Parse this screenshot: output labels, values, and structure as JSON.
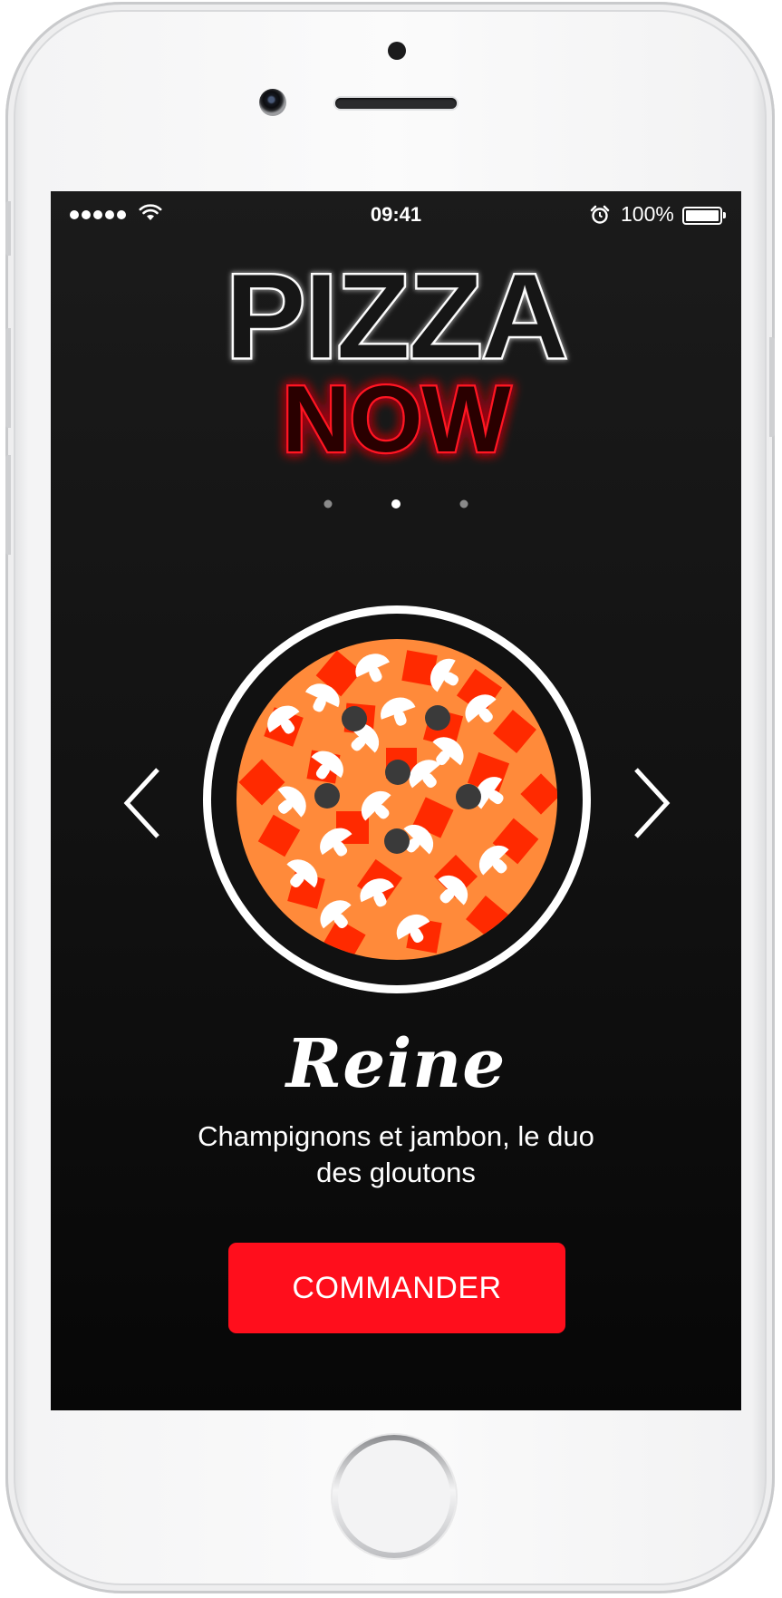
{
  "status_bar": {
    "time": "09:41",
    "battery_percent": "100%",
    "signal_bars": 5,
    "battery_level": 1.0
  },
  "logo": {
    "line1": "PIZZA",
    "line2": "NOW"
  },
  "carousel": {
    "page_count": 3,
    "active_index": 1,
    "prev_icon": "chevron-left-icon",
    "next_icon": "chevron-right-icon"
  },
  "pizza": {
    "name": "Reine",
    "description": "Champignons et jambon, le duo des gloutons"
  },
  "actions": {
    "order_label": "COMMANDER"
  },
  "colors": {
    "accent_red": "#ff0e1c",
    "neon_red": "#ff1220",
    "crust_orange": "#ff8a3a",
    "ham_red": "#ff2a00",
    "background": "#111111"
  }
}
